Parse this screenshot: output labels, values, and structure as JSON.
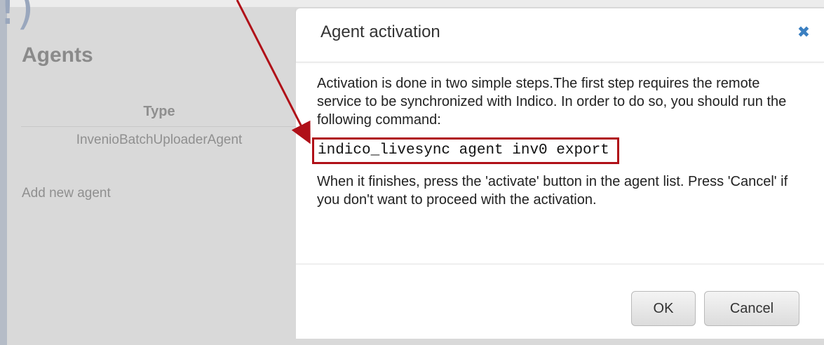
{
  "background": {
    "corner_glyph": "!)",
    "agents_heading": "Agents",
    "table": {
      "column_header": "Type",
      "rows": [
        "InvenioBatchUploaderAgent"
      ]
    },
    "add_agent_link": "Add new agent"
  },
  "dialog": {
    "title": "Agent activation",
    "close_icon": "close-icon",
    "intro_text": "Activation is done in two simple steps.The first step requires the remote service to be synchronized with Indico. In order to do so, you should run the following command:",
    "command": "indico_livesync agent inv0 export",
    "outro_text": "When it finishes, press the 'activate' button in the agent list. Press 'Cancel' if you don't want to proceed with the activation.",
    "buttons": {
      "ok_label": "OK",
      "cancel_label": "Cancel"
    }
  },
  "colors": {
    "annotation": "#b01018",
    "close_icon": "#3a7fc1",
    "backdrop": "#d9d9d9"
  }
}
